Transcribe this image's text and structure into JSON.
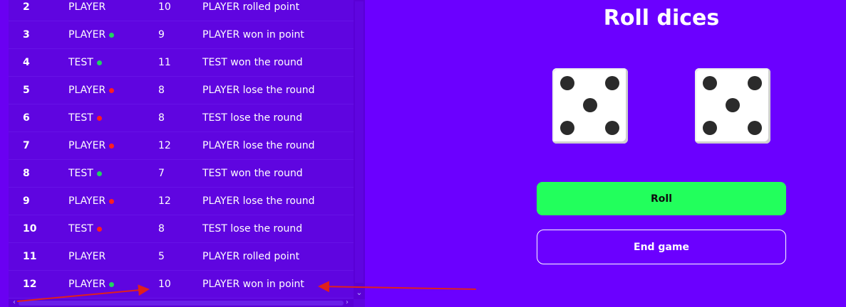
{
  "history": {
    "rows": [
      {
        "num": "2",
        "player": "PLAYER",
        "status": "none",
        "score": "10",
        "description": "PLAYER rolled point"
      },
      {
        "num": "3",
        "player": "PLAYER",
        "status": "win",
        "score": "9",
        "description": "PLAYER won in point"
      },
      {
        "num": "4",
        "player": "TEST",
        "status": "win",
        "score": "11",
        "description": "TEST won the round"
      },
      {
        "num": "5",
        "player": "PLAYER",
        "status": "lose",
        "score": "8",
        "description": "PLAYER lose the round"
      },
      {
        "num": "6",
        "player": "TEST",
        "status": "lose",
        "score": "8",
        "description": "TEST lose the round"
      },
      {
        "num": "7",
        "player": "PLAYER",
        "status": "lose",
        "score": "12",
        "description": "PLAYER lose the round"
      },
      {
        "num": "8",
        "player": "TEST",
        "status": "win",
        "score": "7",
        "description": "TEST won the round"
      },
      {
        "num": "9",
        "player": "PLAYER",
        "status": "lose",
        "score": "12",
        "description": "PLAYER lose the round"
      },
      {
        "num": "10",
        "player": "TEST",
        "status": "lose",
        "score": "8",
        "description": "TEST lose the round"
      },
      {
        "num": "11",
        "player": "PLAYER",
        "status": "none",
        "score": "5",
        "description": "PLAYER rolled point"
      },
      {
        "num": "12",
        "player": "PLAYER",
        "status": "win",
        "score": "10",
        "description": "PLAYER won in point"
      }
    ]
  },
  "game": {
    "title": "Roll dices",
    "dice": [
      5,
      5
    ],
    "roll_label": "Roll",
    "end_label": "End game"
  },
  "colors": {
    "background": "#6b00ff",
    "panel": "#5f05e0",
    "win_dot": "#22d361",
    "lose_dot": "#ff1f1f",
    "roll_button": "#22ff5c",
    "annotation_arrow": "#e0201c"
  },
  "icons": {
    "scroll_down": "chevron-down-icon",
    "scroll_left": "chevron-left-icon",
    "scroll_right": "chevron-right-icon"
  }
}
